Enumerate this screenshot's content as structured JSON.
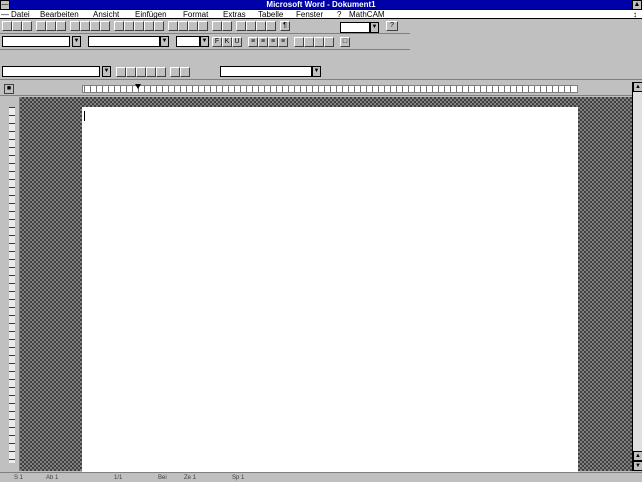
{
  "window": {
    "title": "Microsoft Word - Dokument1",
    "system_menu_icon": "dash-icon",
    "maximize_icon": "up-arrow-icon",
    "document_restore_icon": "updown-icon"
  },
  "menu": {
    "items": [
      "Datei",
      "Bearbeiten",
      "Ansicht",
      "Einfügen",
      "Format",
      "Extras",
      "Tabelle",
      "Fenster",
      "?",
      "MathCAM"
    ]
  },
  "toolbar_standard": {
    "icons": [
      "new-icon",
      "open-icon",
      "save-icon",
      "print-icon",
      "preview-icon",
      "cut-icon",
      "copy-icon",
      "paste-icon",
      "format-painter-icon",
      "undo-icon",
      "redo-icon",
      "autoformat-icon",
      "insert-address-icon",
      "table-icon",
      "excel-icon",
      "columns-icon",
      "drawing-icon",
      "chart-icon",
      "show-all-icon"
    ],
    "zoom_value": "",
    "help_icon": "help-icon"
  },
  "toolbar_formatting": {
    "style_value": "",
    "font_value": "",
    "size_value": "",
    "icons": [
      "bold-icon",
      "italic-icon",
      "underline-icon",
      "align-left-icon",
      "align-center-icon",
      "align-right-icon",
      "justify-icon",
      "numbering-icon",
      "bullets-icon",
      "decrease-indent-icon",
      "increase-indent-icon",
      "borders-icon"
    ]
  },
  "toolbar_borders": {
    "line_style_value": "",
    "shading_value": "",
    "icons": [
      "top-border-icon",
      "bottom-border-icon",
      "left-border-icon",
      "inside-border-icon",
      "right-border-icon",
      "outside-border-icon",
      "no-border-icon"
    ]
  },
  "ruler": {
    "button_icon": "ruler-toggle-icon"
  },
  "scrollbar": {
    "up_icon": "up-arrow-icon",
    "down_icon": "down-arrow-icon",
    "prev_page_icon": "double-up-arrow-icon",
    "next_page_icon": "double-down-arrow-icon"
  },
  "statusbar": {
    "fields": [
      "S 1",
      "Ab 1",
      "1/1",
      "Bei",
      "Ze 1",
      "Sp 1"
    ]
  }
}
